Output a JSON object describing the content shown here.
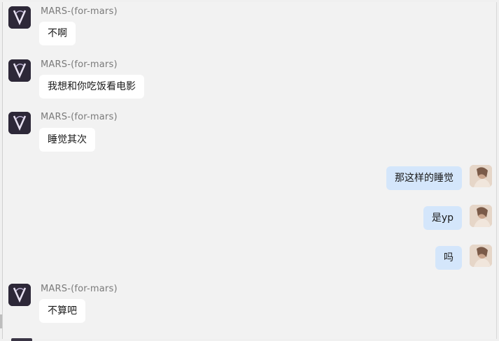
{
  "conversation": {
    "messages": [
      {
        "direction": "incoming",
        "sender": "MARS-(for-mars)",
        "text": "不啊"
      },
      {
        "direction": "incoming",
        "sender": "MARS-(for-mars)",
        "text": "我想和你吃饭看电影"
      },
      {
        "direction": "incoming",
        "sender": "MARS-(for-mars)",
        "text": "睡觉其次"
      },
      {
        "direction": "outgoing",
        "text": "那这样的睡觉"
      },
      {
        "direction": "outgoing",
        "text": "是yp"
      },
      {
        "direction": "outgoing",
        "text": "吗"
      },
      {
        "direction": "incoming",
        "sender": "MARS-(for-mars)",
        "text": "不算吧"
      }
    ]
  },
  "colors": {
    "incoming_bubble": "#ffffff",
    "outgoing_bubble": "#d4e6fb",
    "background": "#f2f2f2",
    "sender_text": "#7a7a7a"
  },
  "icons": {
    "contact_avatar": "dark-purple-logo-avatar",
    "self_avatar": "photo-avatar"
  }
}
